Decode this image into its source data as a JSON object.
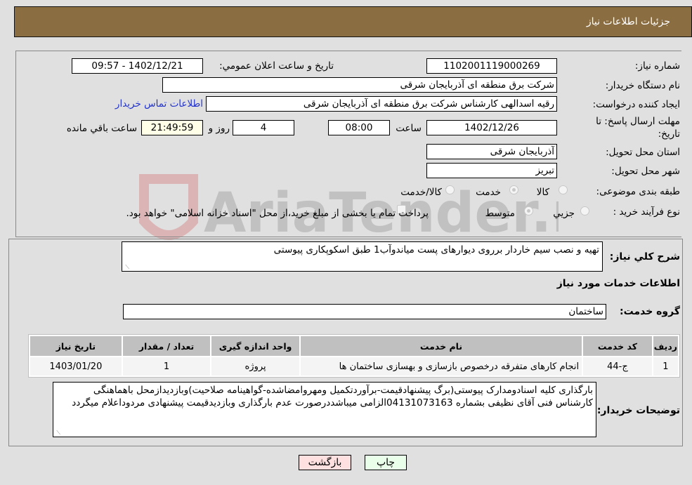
{
  "header": {
    "title": "جزئیات اطلاعات نیاز"
  },
  "form": {
    "need_number": {
      "label": "شماره نیاز:",
      "value": "1102001119000269"
    },
    "announce_datetime": {
      "label": "تاریخ و ساعت اعلان عمومي:",
      "value": "1402/12/21 - 09:57"
    },
    "buyer_org": {
      "label": "نام دستگاه خریدار:",
      "value": "شرکت برق منطقه ای آذربایجان شرقی"
    },
    "requester": {
      "label": "ایجاد کننده درخواست:",
      "value": "رقیه اسدالهی کارشناس شرکت برق منطقه ای آذربایجان شرقی"
    },
    "buyer_contact_link": "اطلاعات تماس خریدار",
    "deadline": {
      "label_line1": "مهلت ارسال پاسخ: تا",
      "label_line2": "تاریخ:",
      "date": "1402/12/26",
      "time_label": "ساعت",
      "time": "08:00",
      "days": "4",
      "days_label": "روز و",
      "remaining": "21:49:59",
      "remaining_label": "ساعت باقي مانده"
    },
    "province": {
      "label": "استان محل تحویل:",
      "value": "آذربایجان شرقی"
    },
    "city": {
      "label": "شهر محل تحویل:",
      "value": "تبریز"
    },
    "category": {
      "label": "طبقه بندی موضوعی:",
      "options": [
        "کالا",
        "خدمت",
        "کالا/خدمت"
      ],
      "selected": "خدمت"
    },
    "purchase_type": {
      "label": "نوع فرآیند خرید :",
      "options": [
        "جزيي",
        "متوسط"
      ],
      "selected": "متوسط",
      "treasury_note": "پرداخت تمام یا بخشی از مبلغ خرید،از محل \"اسناد خزانه اسلامی\" خواهد بود."
    }
  },
  "details": {
    "description_label": "شرح کلي نياز:",
    "description": "تهیه و نصب سیم خاردار برروی دیوارهای پست میاندوآب1 طبق اسکوپکاری پیوستی",
    "services_heading": "اطلاعات خدمات مورد نياز",
    "service_group_label": "گروه خدمت:",
    "service_group": "ساختمان",
    "table": {
      "headers": [
        "ردیف",
        "کد خدمت",
        "نام خدمت",
        "واحد اندازه گیری",
        "تعداد / مقدار",
        "تاریخ نیاز"
      ],
      "rows": [
        [
          "1",
          "ج-44",
          "انجام کارهای متفرقه درخصوص بازسازی و بهسازی ساختمان ها",
          "پروژه",
          "1",
          "1403/01/20"
        ]
      ]
    },
    "buyer_notes_label": "توضیحات خریدار:",
    "buyer_notes": "بارگذاری کلیه اسنادومدارک پیوستی(برگ پیشنهادقیمت-برآوردتکمیل ومهروامضاشده-گواهینامه صلاحیت)وبازدیدازمحل باهماهنگی کارشناس فنی آقای نظیفی بشماره 04131073163الزامی میباشددرصورت عدم بارگذاری وبازدیدقیمت پیشنهادی مردوداعلام میگردد"
  },
  "buttons": {
    "print": "چاپ",
    "back": "بازگشت"
  },
  "watermark": "AriaTender.neT",
  "colors": {
    "header_bg": "#8b6d42",
    "print_bg": "#eaffea",
    "back_bg": "#ffe0e0",
    "link": "#2233cc"
  }
}
